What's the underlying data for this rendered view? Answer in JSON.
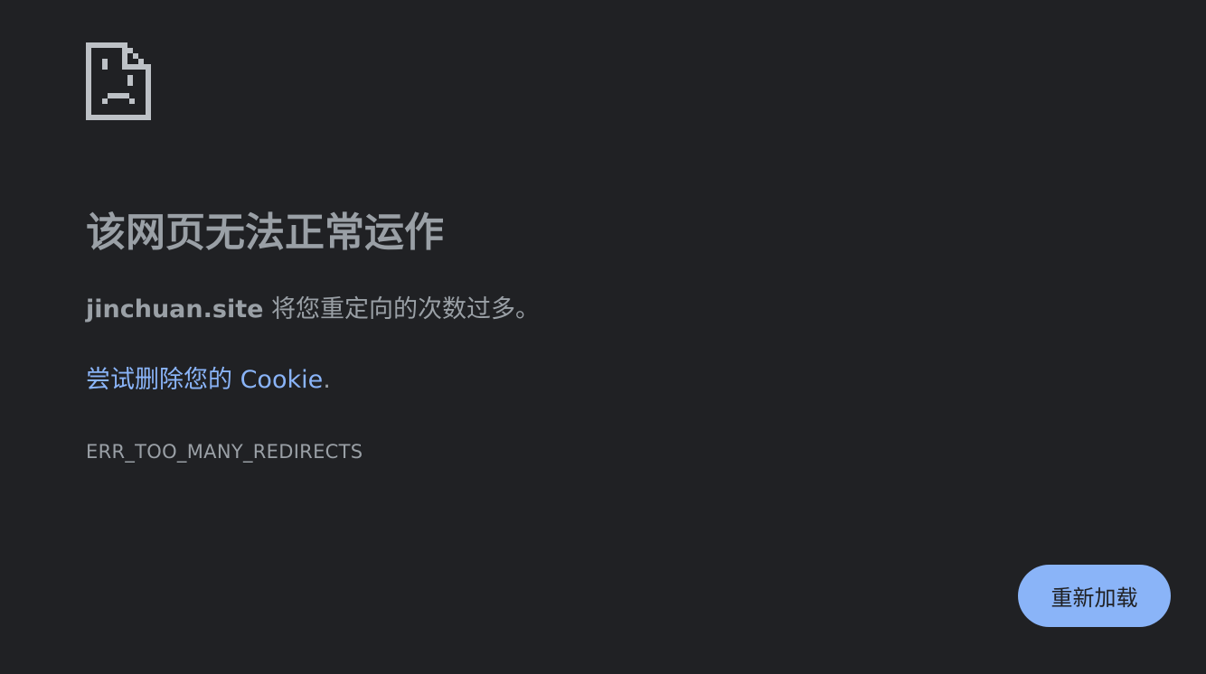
{
  "error": {
    "icon": "sad-page-icon",
    "title": "该网页无法正常运作",
    "host": "jinchuan.site",
    "summary_text": " 将您重定向的次数过多。",
    "suggestion_link": "尝试删除您的 Cookie",
    "suggestion_suffix": ".",
    "code": "ERR_TOO_MANY_REDIRECTS"
  },
  "actions": {
    "reload_label": "重新加载"
  },
  "colors": {
    "background": "#202124",
    "text": "#9aa0a6",
    "link": "#8ab4f8",
    "button_bg": "#8ab4f8",
    "button_text": "#202124",
    "icon": "#bdc1c6"
  }
}
